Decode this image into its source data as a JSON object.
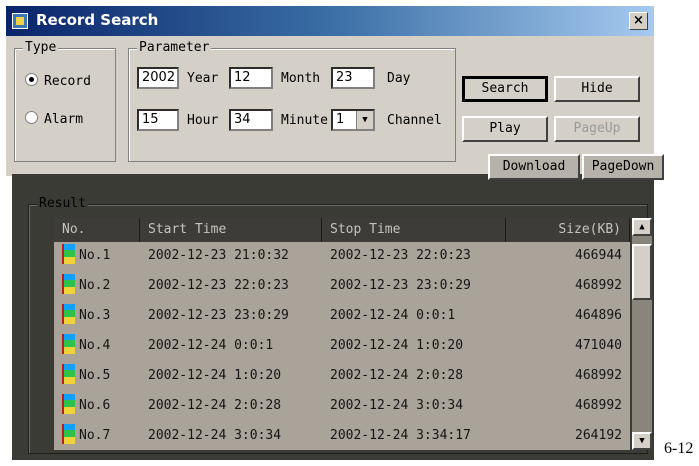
{
  "window": {
    "title": "Record Search",
    "close_label": "×"
  },
  "type_group": {
    "label": "Type",
    "options": [
      {
        "label": "Record",
        "selected": true
      },
      {
        "label": "Alarm",
        "selected": false
      }
    ]
  },
  "parameter_group": {
    "label": "Parameter",
    "year": {
      "value": "2002",
      "label": "Year"
    },
    "month": {
      "value": "12",
      "label": "Month"
    },
    "day": {
      "value": "23",
      "label": "Day"
    },
    "hour": {
      "value": "15",
      "label": "Hour"
    },
    "minute": {
      "value": "34",
      "label": "Minute"
    },
    "channel": {
      "value": "1",
      "label": "Channel"
    }
  },
  "buttons": {
    "search": "Search",
    "hide": "Hide",
    "play": "Play",
    "pageup": "PageUp",
    "download": "Download",
    "pagedown": "PageDown"
  },
  "result_group": {
    "label": "Result",
    "columns": [
      "No.",
      "Start Time",
      "Stop Time",
      "Size(KB)"
    ],
    "rows": [
      {
        "no": "No.1",
        "start": "2002-12-23 21:0:32",
        "stop": "2002-12-23 22:0:23",
        "size": "466944"
      },
      {
        "no": "No.2",
        "start": "2002-12-23 22:0:23",
        "stop": "2002-12-23 23:0:29",
        "size": "468992"
      },
      {
        "no": "No.3",
        "start": "2002-12-23 23:0:29",
        "stop": "2002-12-24 0:0:1",
        "size": "464896"
      },
      {
        "no": "No.4",
        "start": "2002-12-24 0:0:1",
        "stop": "2002-12-24 1:0:20",
        "size": "471040"
      },
      {
        "no": "No.5",
        "start": "2002-12-24 1:0:20",
        "stop": "2002-12-24 2:0:28",
        "size": "468992"
      },
      {
        "no": "No.6",
        "start": "2002-12-24 2:0:28",
        "stop": "2002-12-24 3:0:34",
        "size": "468992"
      },
      {
        "no": "No.7",
        "start": "2002-12-24 3:0:34",
        "stop": "2002-12-24 3:34:17",
        "size": "264192"
      }
    ]
  },
  "page_number": "6-12"
}
